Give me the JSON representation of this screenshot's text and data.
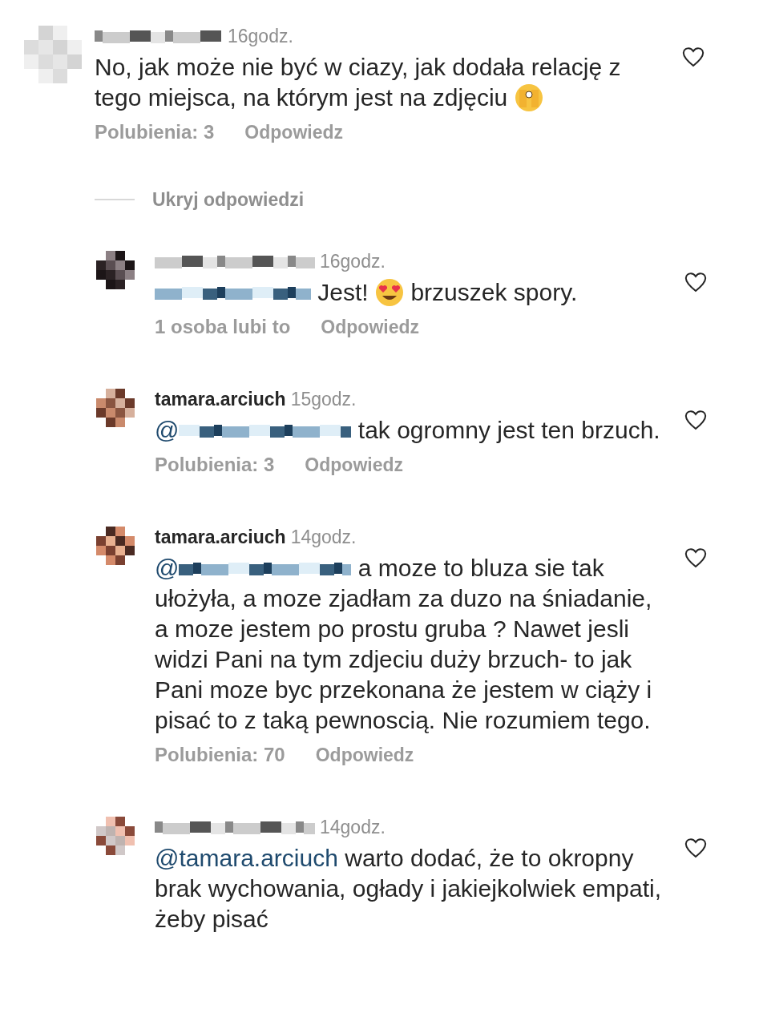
{
  "comments": [
    {
      "name_censored": true,
      "time": "16godz.",
      "liked": false,
      "body": [
        {
          "kind": "text",
          "text": "No, jak może nie być w ciazy, jak dodała relację z tego miejsca, na którym jest na zdjęciu"
        },
        {
          "kind": "peeking"
        }
      ],
      "likes": "Polubienia: 3",
      "reply": "Odpowiedz",
      "replies_toggle": "Ukryj odpowiedzi",
      "replies": [
        {
          "name_censored": true,
          "time": "16godz.",
          "liked": false,
          "body": [
            {
              "kind": "censored"
            },
            {
              "kind": "text",
              "text": "Jest!"
            },
            {
              "kind": "hearteyes"
            },
            {
              "kind": "text",
              "text": "brzuszek spory."
            }
          ],
          "likes": "1 osoba lubi to",
          "reply": "Odpowiedz"
        },
        {
          "username": "tamara.arciuch",
          "time": "15godz.",
          "liked": false,
          "body": [
            {
              "kind": "censored",
              "text": "@"
            },
            {
              "kind": "text",
              "text": "tak ogromny jest ten brzuch."
            }
          ],
          "likes": "Polubienia: 3",
          "reply": "Odpowiedz"
        },
        {
          "username": "tamara.arciuch",
          "time": "14godz.",
          "liked": false,
          "body": [
            {
              "kind": "censored",
              "text": "@"
            },
            {
              "kind": "text",
              "text": "a moze to bluza sie tak ułożyła, a moze zjadłam za duzo na śniadanie, a moze jestem po prostu gruba ? Nawet jesli widzi Pani na tym zdjeciu duży brzuch- to jak Pani moze byc przekonana że jestem w ciąży i pisać to z taką pewnoscią. Nie rozumiem tego."
            }
          ],
          "likes": "Polubienia: 70",
          "reply": "Odpowiedz"
        },
        {
          "name_censored": true,
          "time": "14godz.",
          "liked": false,
          "body": [
            {
              "kind": "mention",
              "text": "@tamara.arciuch"
            },
            {
              "kind": "text",
              "text": "warto dodać, że to okropny brak wychowania, ogłady i jakiejkolwiek empati, żeby pisać"
            }
          ]
        }
      ]
    }
  ]
}
